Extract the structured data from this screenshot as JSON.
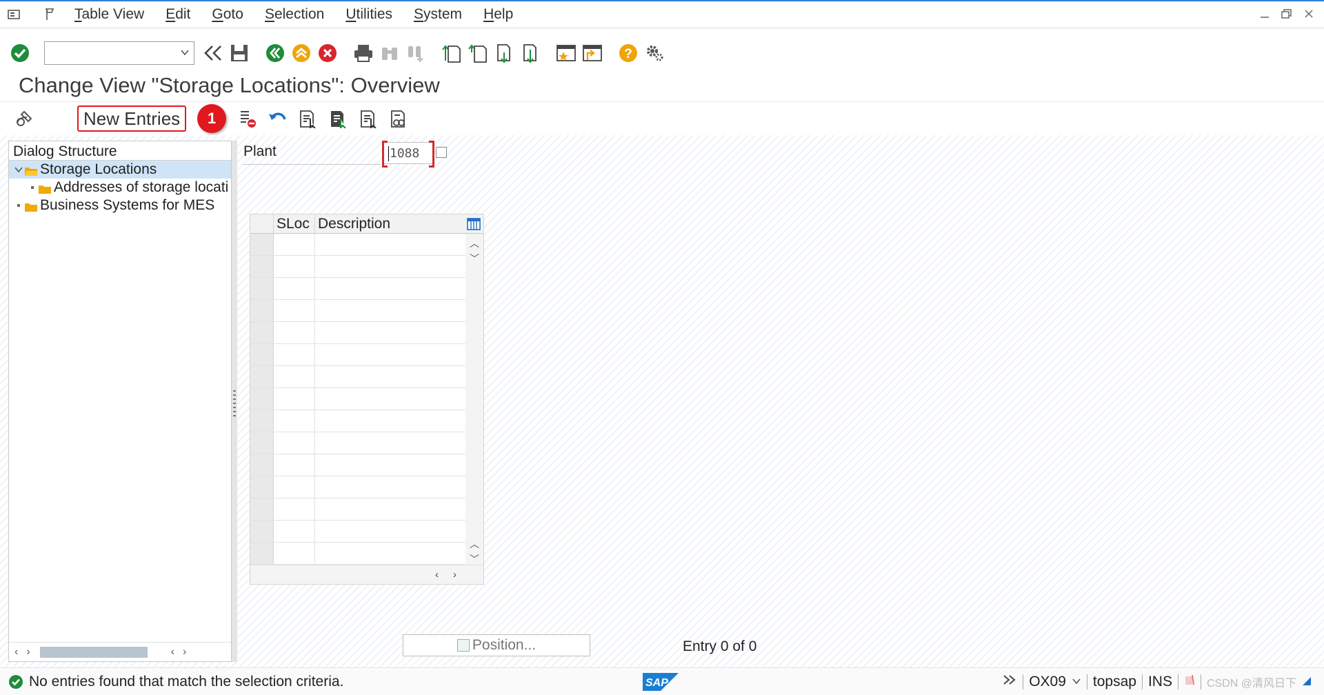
{
  "menu": {
    "items": [
      {
        "label": "Table View",
        "underline": "T",
        "rest": "able View"
      },
      {
        "label": "Edit",
        "underline": "E",
        "rest": "dit"
      },
      {
        "label": "Goto",
        "underline": "G",
        "rest": "oto"
      },
      {
        "label": "Selection",
        "underline": "S",
        "rest": "election"
      },
      {
        "label": "Utilities",
        "underline": "U",
        "rest": "tilities"
      },
      {
        "label": "System",
        "underline": "S",
        "rest": "ystem"
      },
      {
        "label": "Help",
        "underline": "H",
        "rest": "elp"
      }
    ]
  },
  "toolbar": {
    "command_field_value": "",
    "icons": [
      "enter-icon",
      "back-double-arrow-icon",
      "save-icon",
      "back-icon",
      "exit-icon",
      "cancel-icon",
      "print-icon",
      "find-icon",
      "find-next-icon",
      "first-page-icon",
      "previous-page-icon",
      "next-page-icon",
      "last-page-icon",
      "new-session-icon",
      "create-shortcut-icon",
      "help-icon",
      "settings-icon"
    ]
  },
  "page": {
    "title": "Change View \"Storage Locations\": Overview"
  },
  "app_toolbar": {
    "new_entries_label": "New Entries",
    "badge_number": "1",
    "icons": [
      "display-change-icon",
      "delete-icon",
      "undo-icon",
      "select-all-icon",
      "select-block-icon",
      "deselect-all-icon",
      "variant-icon"
    ]
  },
  "dialog": {
    "heading": "Dialog Structure",
    "tree": [
      {
        "label": "Storage Locations",
        "level": 0,
        "expanded": true,
        "selected": true
      },
      {
        "label": "Addresses of storage locati",
        "level": 1,
        "expanded": false,
        "selected": false
      },
      {
        "label": "Business Systems for MES",
        "level": 0,
        "expanded": false,
        "selected": false
      }
    ]
  },
  "plant": {
    "label": "Plant",
    "value": "1088"
  },
  "table": {
    "columns": [
      "SLoc",
      "Description"
    ],
    "row_count": 15
  },
  "footer": {
    "position_label": "Position...",
    "entry_counter": "Entry 0 of 0"
  },
  "status": {
    "message": "No entries found that match the selection criteria.",
    "transaction": "OX09",
    "server": "topsap",
    "mode": "INS",
    "watermark": "CSDN @清风日下"
  },
  "colors": {
    "accent": "#2d7fd6",
    "highlight_red": "#e0191e",
    "success_green": "#1e8c3a",
    "selection_blue": "#cfe4f7"
  }
}
